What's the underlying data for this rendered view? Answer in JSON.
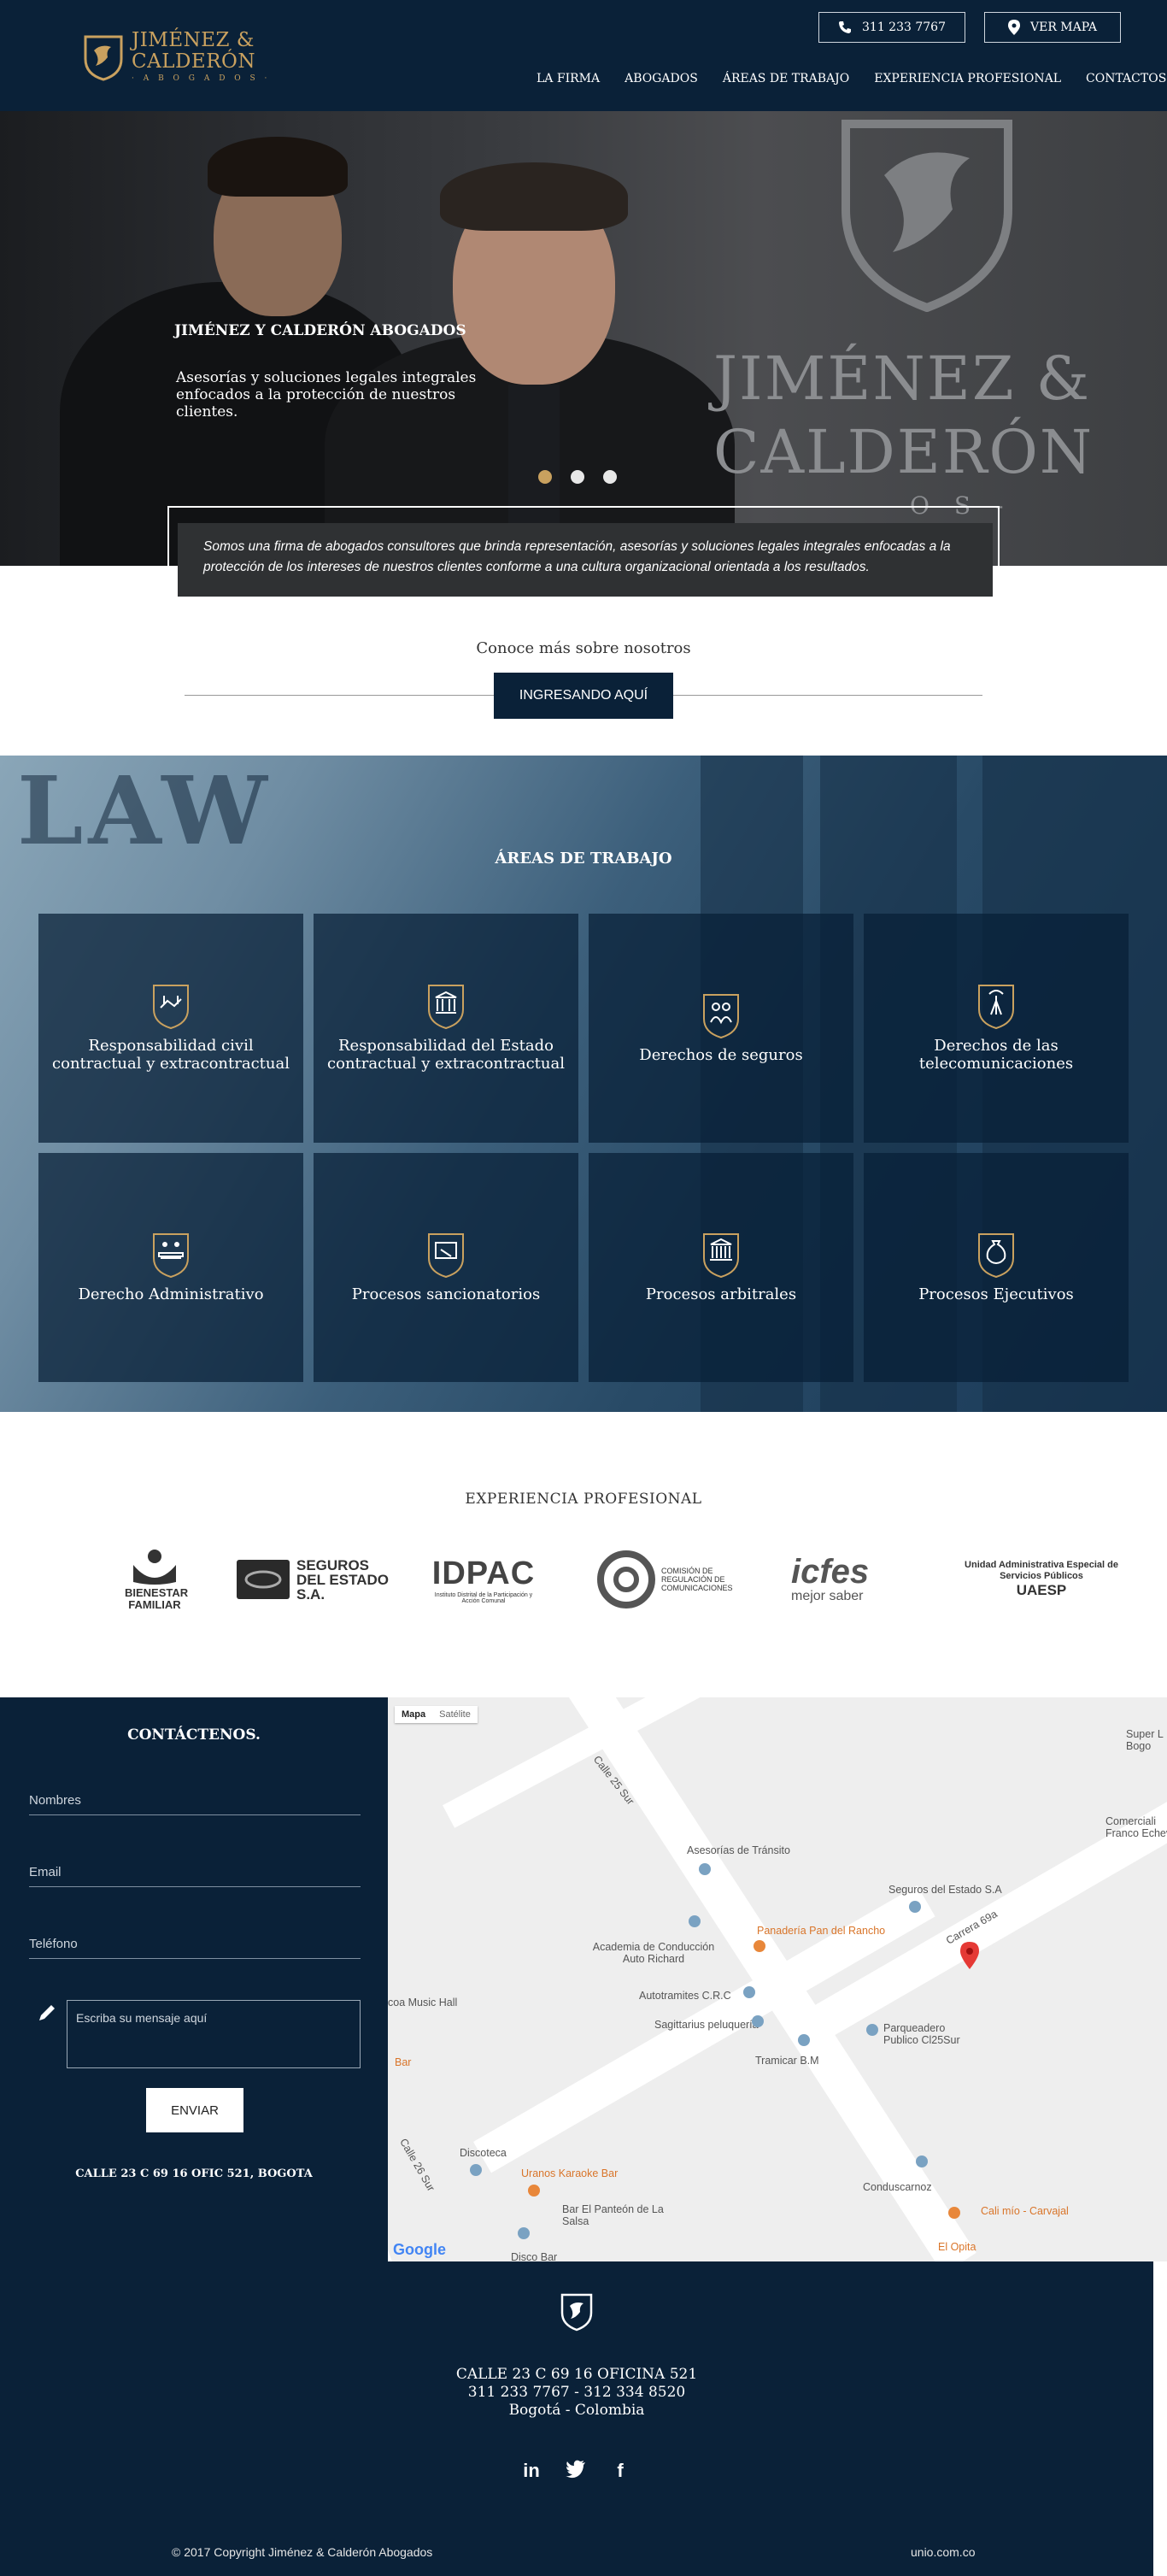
{
  "header": {
    "logo": {
      "line1": "JIMÉNEZ &",
      "line2": "CALDERÓN",
      "line3": "· A B O G A D O S ·"
    },
    "phone_label": "311 233 7767",
    "map_label": "VER MAPA",
    "nav": [
      "LA FIRMA",
      "ABOGADOS",
      "ÁREAS DE TRABAJO",
      "EXPERIENCIA PROFESIONAL",
      "CONTACTOS"
    ]
  },
  "hero": {
    "title": "JIMÉNEZ Y CALDERÓN ABOGADOS",
    "subtitle": "Asesorías y soluciones legales integrales enfocados a la protección de nuestros clientes.",
    "brand_line1": "JIMÉNEZ &",
    "brand_line2": "CALDERÓN",
    "brand_line3": "O S -",
    "slides": 3,
    "active_slide": 1
  },
  "intro": {
    "text": "Somos una firma de abogados consultores que brinda representación, asesorías y soluciones legales integrales enfocadas a la protección de los intereses de nuestros clientes conforme a una cultura organizacional orientada a los resultados."
  },
  "about_cta": {
    "heading": "Conoce más sobre nosotros",
    "button_label": "INGRESANDO AQUÍ"
  },
  "areas": {
    "title": "ÁREAS DE TRABAJO",
    "background_text": "LAW",
    "items": [
      {
        "label": "Responsabilidad civil contractual y extracontractual",
        "icon": "handshake-icon"
      },
      {
        "label": "Responsabilidad del Estado contractual y extracontractual",
        "icon": "government-building-icon"
      },
      {
        "label": "Derechos de seguros",
        "icon": "insurance-family-icon"
      },
      {
        "label": "Derechos de las telecomunicaciones",
        "icon": "antenna-icon"
      },
      {
        "label": "Derecho Administrativo",
        "icon": "meeting-icon"
      },
      {
        "label": "Procesos sancionatorios",
        "icon": "gavel-icon"
      },
      {
        "label": "Procesos arbitrales",
        "icon": "courthouse-icon"
      },
      {
        "label": "Procesos Ejecutivos",
        "icon": "money-bag-icon"
      }
    ]
  },
  "experience": {
    "title": "EXPERIENCIA PROFESIONAL",
    "clients": [
      {
        "name": "BIENESTAR FAMILIAR"
      },
      {
        "name": "SEGUROS DEL ESTADO S.A."
      },
      {
        "name": "IDPAC",
        "tagline": "Instituto Distrital de la Participación y Acción Comunal"
      },
      {
        "name": "COMISIÓN DE REGULACIÓN DE COMUNICACIONES"
      },
      {
        "name": "icfes",
        "tagline": "mejor saber"
      },
      {
        "name": "UAESP",
        "tagline": "Unidad Administrativa Especial de Servicios Públicos"
      }
    ]
  },
  "contact": {
    "title": "CONTÁCTENOS.",
    "name_placeholder": "Nombres",
    "email_placeholder": "Email",
    "phone_placeholder": "Teléfono",
    "message_placeholder": "Escriba su mensaje aquí",
    "submit_label": "ENVIAR",
    "address": "CALLE 23 C 69 16 OFIC 521, BOGOTA"
  },
  "map": {
    "tab_map": "Mapa",
    "tab_satellite": "Satélite",
    "google": "Google",
    "labels": [
      "Calle 25 Sur",
      "Asesorías de Tránsito",
      "Seguros del Estado S.A",
      "Panadería Pan del Rancho",
      "Academia de Conducción Auto Richard",
      "Carrera 69a",
      "Autotramites C.R.C",
      "Sagittarius peluquería",
      "Parqueadero Publico Cl25Sur",
      "Tramicar B.M",
      "coa Music Hall",
      "Bar",
      "Calle 26 Sur",
      "Discoteca",
      "Uranos Karaoke Bar",
      "Bar El Panteón de La Salsa",
      "Conduscarnoz",
      "Cali mío - Carvajal",
      "El Opita",
      "Super L Bogo",
      "Comerciali Franco Echeve",
      "Disco Bar"
    ]
  },
  "footer": {
    "address_line1": "CALLE 23 C 69 16 OFICINA 521",
    "address_line2": "311 233 7767 - 312 334 8520",
    "address_line3": "Bogotá - Colombia",
    "social": [
      "in",
      "twitter",
      "f"
    ],
    "copyright": "© 2017 Copyright Jiménez & Calderón Abogados",
    "credit": "unio.com.co"
  }
}
